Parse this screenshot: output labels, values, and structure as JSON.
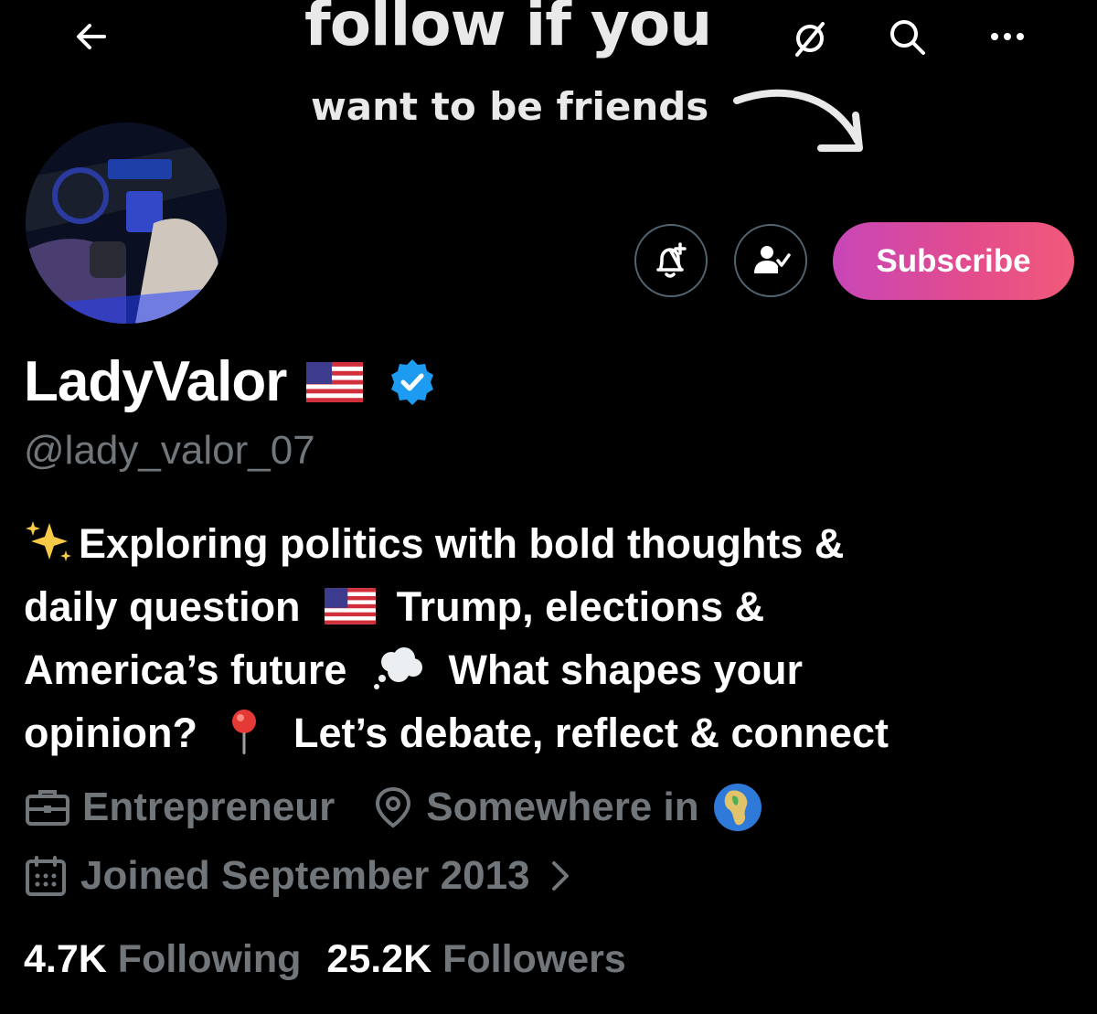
{
  "banner": {
    "line1": "follow if you",
    "line2": "want to be friends"
  },
  "header": {
    "back_icon": "arrow-left-icon",
    "grok_icon": "grok-icon",
    "search_icon": "search-icon",
    "more_icon": "more-icon"
  },
  "actions": {
    "notify_icon": "bell-plus-icon",
    "following_icon": "person-check-icon",
    "subscribe_label": "Subscribe"
  },
  "profile": {
    "name": "LadyValor",
    "handle": "@lady_valor_07",
    "verified": true,
    "bio": {
      "line1": "Exploring politics with bold thoughts &",
      "line2a": "daily question",
      "line2b": "Trump, elections &",
      "line3a": "America’s future",
      "line3b": "What shapes your",
      "line4a": "opinion?",
      "line4b": "Let’s debate, reflect & connect"
    },
    "profession": "Entrepreneur",
    "location": "Somewhere in",
    "joined": "Joined September 2013"
  },
  "stats": {
    "following_count": "4.7K",
    "following_label": "Following",
    "followers_count": "25.2K",
    "followers_label": "Followers"
  },
  "colors": {
    "background": "#000000",
    "muted": "#71767b",
    "verified": "#1d9bf0",
    "subscribe_start": "#c846b8",
    "subscribe_end": "#f05a7a"
  }
}
